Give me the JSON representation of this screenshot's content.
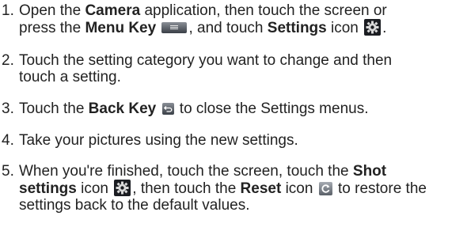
{
  "steps": [
    {
      "number": "1.",
      "line1": {
        "t1": "Open the ",
        "b1": "Camera",
        "t2": " application, then touch the screen or"
      },
      "line2": {
        "t1": "press the ",
        "b1": "Menu Key",
        "t2": ", and touch ",
        "b2": "Settings",
        "t3": " icon",
        "t4": "."
      }
    },
    {
      "number": "2.",
      "line1": "Touch the setting category you want to change and then",
      "line2": "touch a setting."
    },
    {
      "number": "3.",
      "t1": "Touch the ",
      "b1": "Back Key",
      "t2": " to close the Settings menus."
    },
    {
      "number": "4.",
      "text": "Take your pictures using the new settings."
    },
    {
      "number": "5.",
      "line1": {
        "t1": "When you're finished, touch the screen, touch the ",
        "b1": "Shot"
      },
      "line2": {
        "b1": "settings",
        "t1": " icon ",
        "t2": ", then touch the ",
        "b2": "Reset",
        "t3": " icon ",
        "t4": " to restore the"
      },
      "line3": "settings back to the default values."
    }
  ],
  "icons": {
    "menu_key": "menu-key-icon",
    "settings": "gear-icon",
    "back_key": "back-key-icon",
    "reset": "reset-icon"
  },
  "colors": {
    "text": "#222222",
    "background": "#ffffff",
    "icon_dark": "#1b1d22",
    "key_gray": "#5f646b"
  }
}
